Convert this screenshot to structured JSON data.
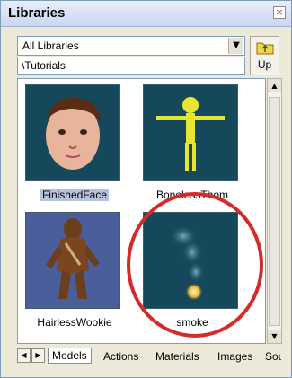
{
  "panel": {
    "title": "Libraries",
    "close_icon": "close-icon",
    "close_glyph": "×"
  },
  "toolbar": {
    "library_select": "All Libraries",
    "path": "\\Tutorials",
    "up_label": "Up"
  },
  "items": [
    {
      "label": "FinishedFace",
      "selected": true
    },
    {
      "label": "BonelessThom",
      "selected": false
    },
    {
      "label": "HairlessWookie",
      "selected": false
    },
    {
      "label": "smoke",
      "selected": false
    }
  ],
  "tabs": [
    "Models",
    "Actions",
    "Materials",
    "Images",
    "Sou"
  ],
  "active_tab": "Models",
  "colors": {
    "highlight_circle": "#d42a2a",
    "thumbnail_bg": "#14485a",
    "selection": "#b7c3de"
  }
}
